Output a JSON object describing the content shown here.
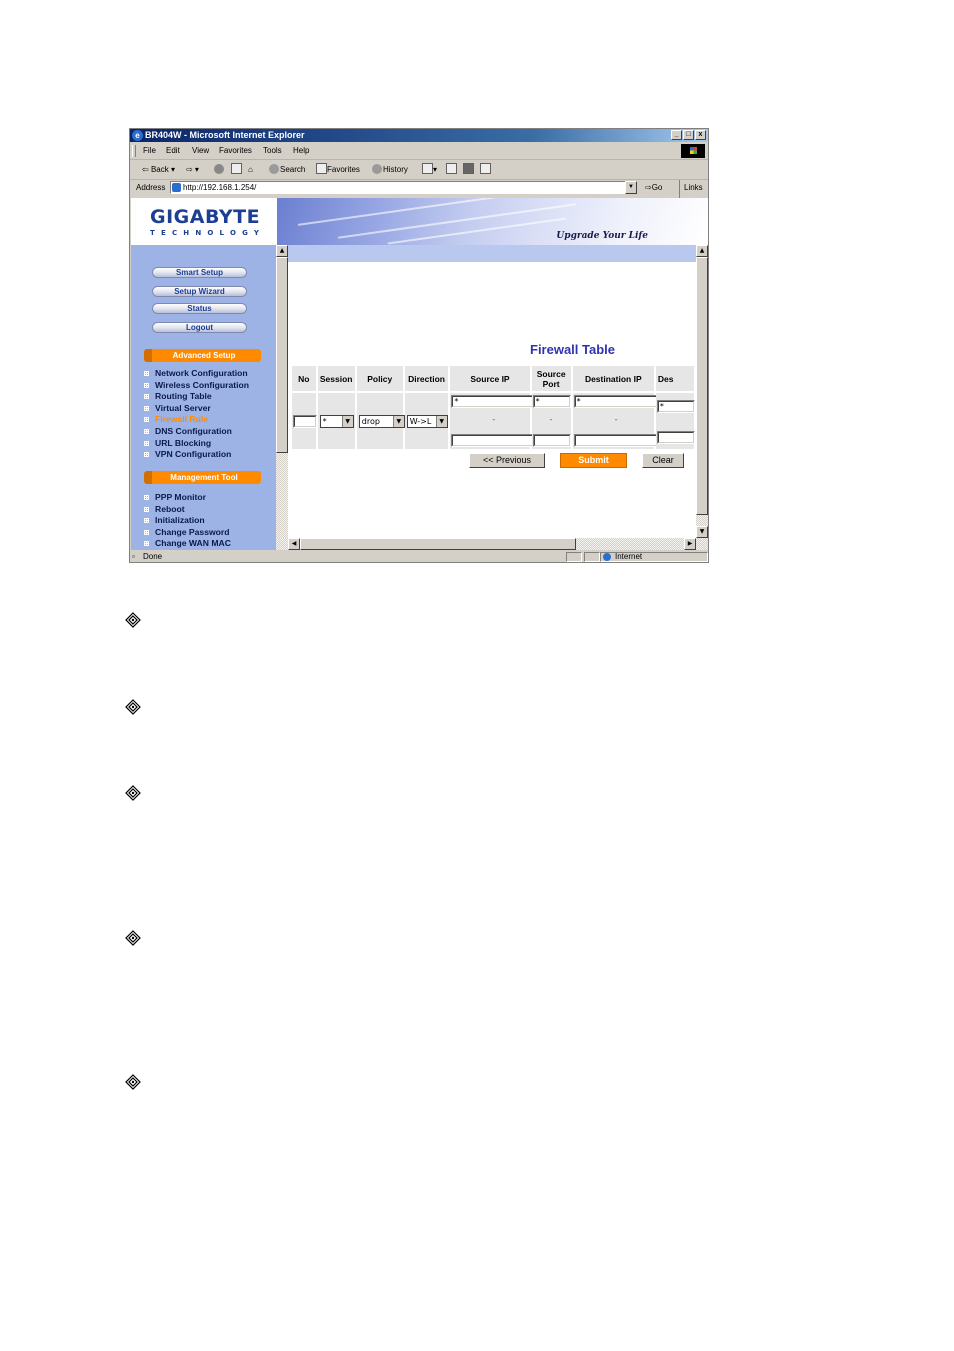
{
  "window": {
    "title": "BR404W - Microsoft Internet Explorer",
    "buttons": [
      "_",
      "□",
      "x"
    ]
  },
  "menu": [
    "File",
    "Edit",
    "View",
    "Favorites",
    "Tools",
    "Help"
  ],
  "toolbar": {
    "back": "Back",
    "search": "Search",
    "favorites": "Favorites",
    "history": "History"
  },
  "address": {
    "label": "Address",
    "url": "http://192.168.1.254/",
    "go": "Go",
    "links": "Links"
  },
  "banner": {
    "logo": "GIGABYTE",
    "logo_sub": "TECHNOLOGY",
    "tagline": "Upgrade Your Life"
  },
  "sidebar": {
    "buttons": [
      "Smart Setup",
      "Setup Wizard",
      "Status",
      "Logout"
    ],
    "advanced_title": "Advanced Setup",
    "advanced_items": [
      "Network Configuration",
      "Wireless Configuration",
      "Routing Table",
      "Virtual Server",
      "Firewall Rule",
      "DNS Configuration",
      "URL Blocking",
      "VPN Configuration"
    ],
    "active_item": "Firewall Rule",
    "management_title": "Management Tool",
    "management_items": [
      "PPP Monitor",
      "Reboot",
      "Initialization",
      "Change Password",
      "Change WAN MAC"
    ]
  },
  "firewall": {
    "title": "Firewall Table",
    "columns": [
      "No",
      "Session",
      "Policy",
      "Direction",
      "Source IP",
      "Source Port",
      "Destination IP",
      "Des"
    ],
    "row": {
      "no": "",
      "session": "*",
      "policy": "drop",
      "direction": "W->L",
      "source_ip_start": "*",
      "source_ip_end": "",
      "source_port_start": "*",
      "source_port_end": "",
      "dest_ip_start": "*",
      "dest_ip_end": "",
      "dest_port_start": "*",
      "range_sep": "-"
    },
    "buttons": {
      "previous": "<< Previous",
      "submit": "Submit",
      "clear": "Clear"
    }
  },
  "status": {
    "left": "Done",
    "zone": "Internet"
  }
}
